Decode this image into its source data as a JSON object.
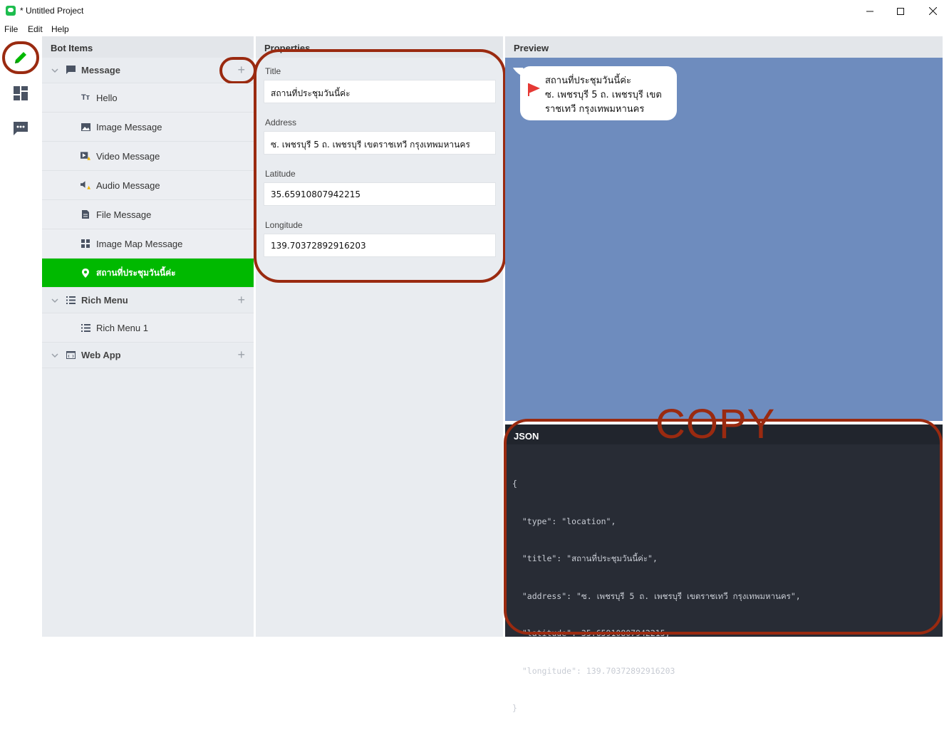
{
  "window": {
    "title": "* Untitled Project",
    "controls": {
      "minimize": "—",
      "maximize": "☐",
      "close": "✕"
    }
  },
  "menu": [
    "File",
    "Edit",
    "Help"
  ],
  "rail": {
    "items": [
      {
        "icon": "pencil-icon",
        "active": true
      },
      {
        "icon": "dashboard-icon",
        "active": false
      },
      {
        "icon": "chat-icon",
        "active": false
      }
    ]
  },
  "bot_items": {
    "header": "Bot Items",
    "groups": [
      {
        "label": "Message",
        "icon": "message-icon",
        "add": "+",
        "children": [
          {
            "label": "Hello",
            "icon": "text-icon",
            "icon_text": "Tт"
          },
          {
            "label": "Image Message",
            "icon": "image-icon"
          },
          {
            "label": "Video Message",
            "icon": "video-warning-icon"
          },
          {
            "label": "Audio Message",
            "icon": "audio-warning-icon"
          },
          {
            "label": "File Message",
            "icon": "file-icon"
          },
          {
            "label": "Image Map Message",
            "icon": "grid-icon"
          },
          {
            "label": "สถานที่ประชุมวันนี้ค่ะ",
            "icon": "location-pin-icon",
            "selected": true
          }
        ]
      },
      {
        "label": "Rich Menu",
        "icon": "list-icon",
        "add": "+",
        "children": [
          {
            "label": "Rich Menu 1",
            "icon": "list-icon"
          }
        ]
      },
      {
        "label": "Web App",
        "icon": "webapp-icon",
        "add": "+",
        "children": []
      }
    ]
  },
  "properties": {
    "header": "Properties",
    "fields": [
      {
        "label": "Title",
        "value": "สถานที่ประชุมวันนี้ค่ะ"
      },
      {
        "label": "Address",
        "value": "ซ. เพชรบุรี 5 ถ. เพชรบุรี เขตราชเทวี กรุงเทพมหานคร"
      },
      {
        "label": "Latitude",
        "value": "35.65910807942215"
      },
      {
        "label": "Longitude",
        "value": "139.70372892916203"
      }
    ]
  },
  "preview": {
    "header": "Preview",
    "bubble_lines": [
      "สถานที่ประชุมวันนี้ค่ะ",
      "ซ. เพชรบุรี 5 ถ. เพชรบุรี เขต",
      "ราชเทวี กรุงเทพมหานคร"
    ],
    "background": "#6e8cbe"
  },
  "json": {
    "header": "JSON",
    "lines": [
      "{",
      "  \"type\": \"location\",",
      "  \"title\": \"สถานที่ประชุมวันนี้ค่ะ\",",
      "  \"address\": \"ซ. เพชรบุรี 5 ถ. เพชรบุรี เขตราชเทวี กรุงเทพมหานคร\",",
      "  \"latitude\": 35.65910807942215,",
      "  \"longitude\": 139.70372892916203",
      "}"
    ]
  },
  "annotation": {
    "text": "COPY",
    "color": "#9a2a10"
  },
  "colors": {
    "accent": "#00b900",
    "panel": "#e9ecf0",
    "json_bg": "#282c35"
  }
}
